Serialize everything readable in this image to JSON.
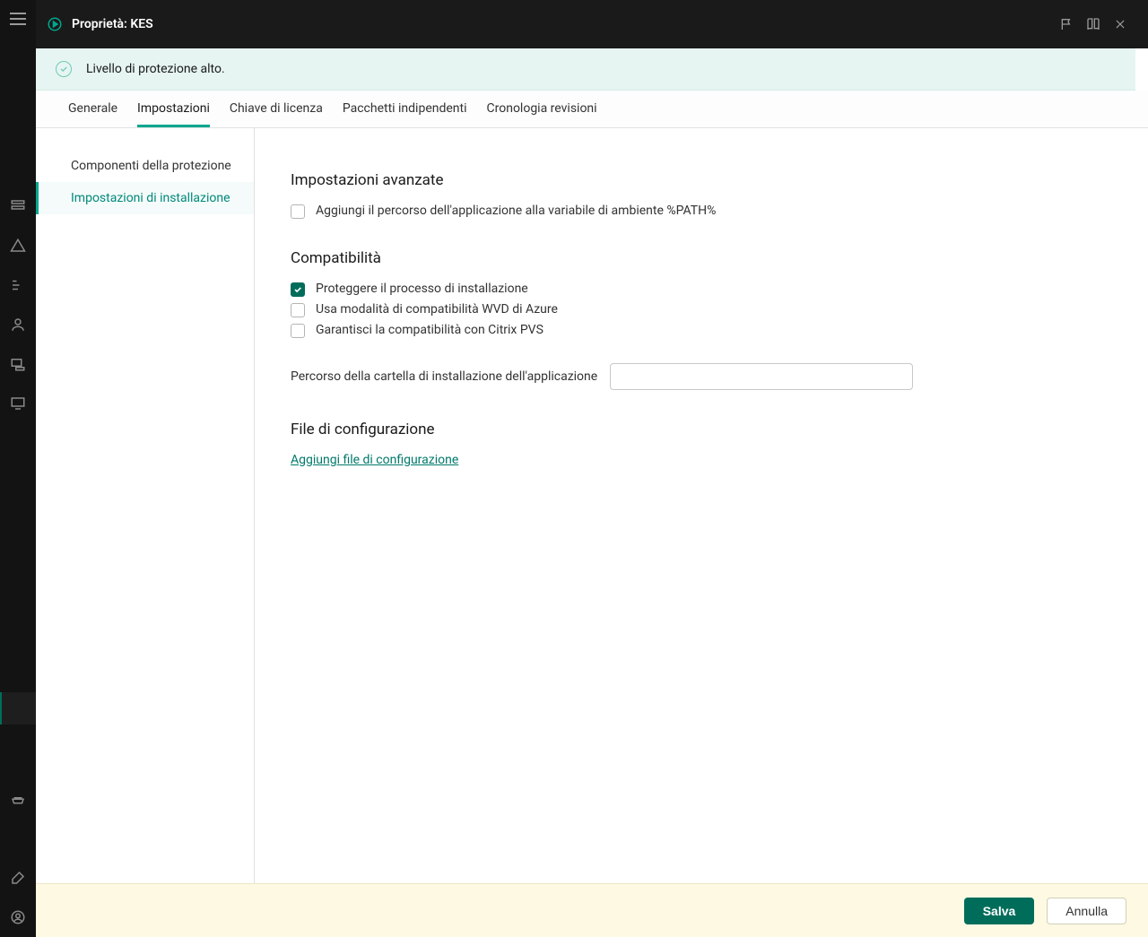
{
  "header": {
    "title": "Proprietà: KES"
  },
  "status": {
    "text": "Livello di protezione alto."
  },
  "tabs": {
    "generale": "Generale",
    "impostazioni": "Impostazioni",
    "chiave": "Chiave di licenza",
    "pacchetti": "Pacchetti indipendenti",
    "cronologia": "Cronologia revisioni"
  },
  "sidebar": {
    "componenti": "Componenti della protezione",
    "installazione": "Impostazioni di installazione"
  },
  "form": {
    "advanced_title": "Impostazioni avanzate",
    "add_path_label": "Aggiungi il percorso dell'applicazione alla variabile di ambiente %PATH%",
    "compat_title": "Compatibilità",
    "protect_install_label": "Proteggere il processo di installazione",
    "azure_wvd_label": "Usa modalità di compatibilità WVD di Azure",
    "citrix_label": "Garantisci la compatibilità con Citrix PVS",
    "install_folder_label": "Percorso della cartella di installazione dell'applicazione",
    "install_folder_value": "",
    "config_title": "File di configurazione",
    "add_config_link": "Aggiungi file di configurazione"
  },
  "footer": {
    "save": "Salva",
    "cancel": "Annulla"
  }
}
